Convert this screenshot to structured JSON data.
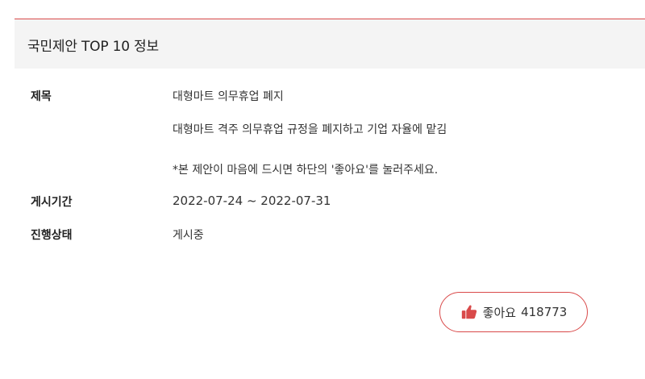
{
  "header": {
    "title": "국민제안 TOP 10 정보"
  },
  "details": {
    "title_label": "제목",
    "title_value": "대형마트 의무휴업 폐지",
    "description": "대형마트 격주 의무휴업 규정을 폐지하고 기업 자율에 맡김",
    "note": "*본 제안이 마음에 드시면 하단의 '좋아요'를 눌러주세요.",
    "period_label": "게시기간",
    "period_value": "2022-07-24 ~ 2022-07-31",
    "status_label": "진행상태",
    "status_value": "게시중"
  },
  "like": {
    "label": "좋아요",
    "count": "418773",
    "icon": "thumbs-up-icon"
  },
  "colors": {
    "accent": "#d94a4a",
    "header_bg": "#f4f4f4"
  }
}
